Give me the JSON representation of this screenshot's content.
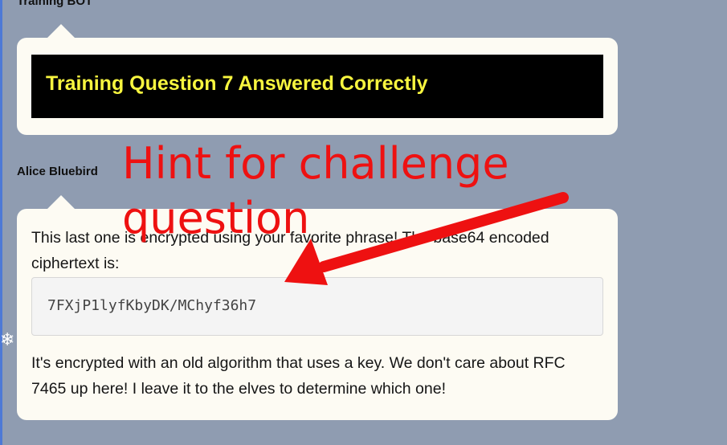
{
  "training_message": {
    "sender": "Training BOT",
    "result": "Training Question 7 Answered Correctly"
  },
  "alice_message": {
    "sender": "Alice Bluebird",
    "intro": "This last one is encrypted using your favorite phrase! The base64 encoded ciphertext is:",
    "ciphertext": "7FXjP1lyfKbyDK/MChyf36h7",
    "outro": "It's encrypted with an old algorithm that uses a key. We don't care about RFC 7465 up here! I leave it to the elves to determine which one!"
  },
  "annotation": {
    "text": "Hint for challenge question",
    "color": "#ee1111"
  },
  "icons": {
    "gear": "gear-icon",
    "gear_glyph": "❄"
  }
}
